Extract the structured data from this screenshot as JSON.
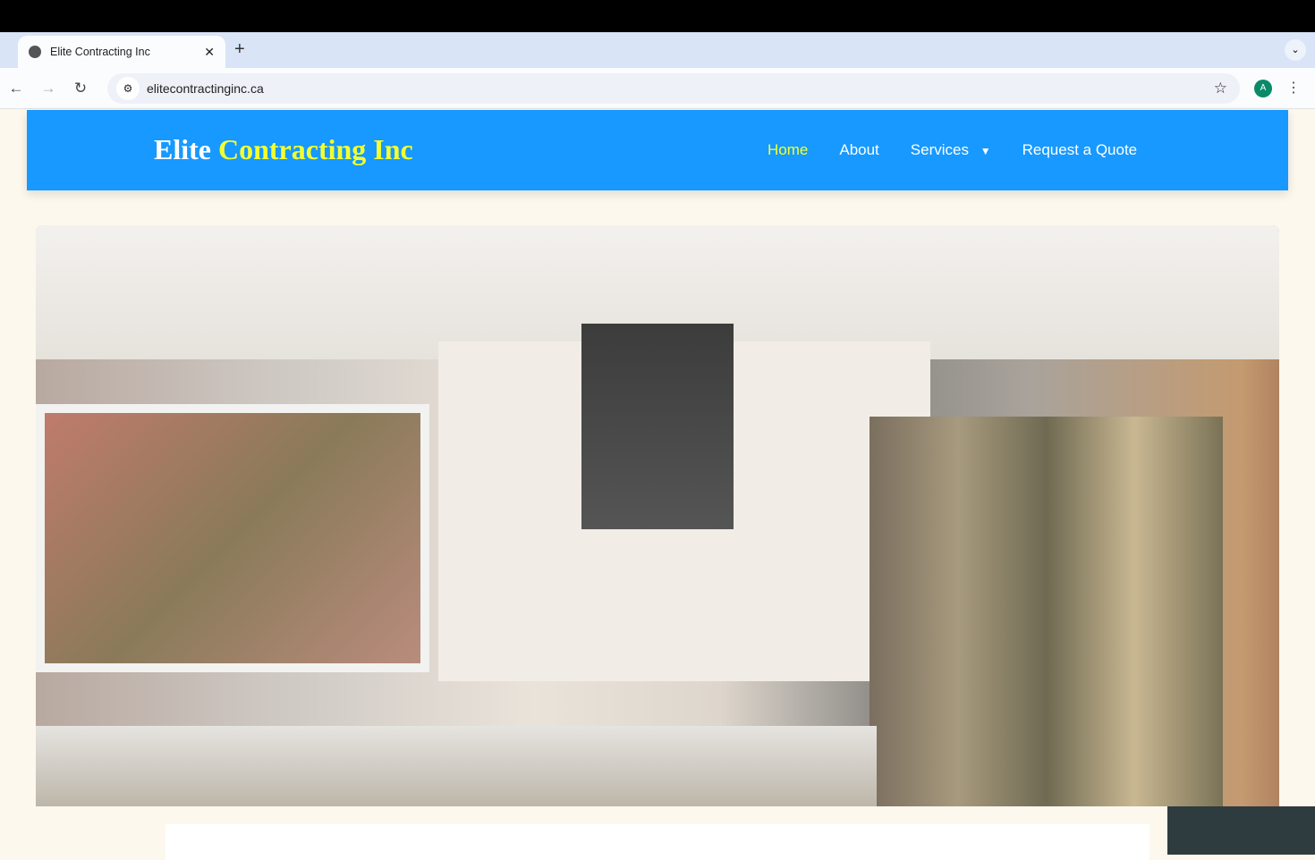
{
  "browser": {
    "tab_title": "Elite Contracting Inc",
    "url": "elitecontractinginc.ca",
    "avatar_letter": "A",
    "icons": {
      "tab": "globe-icon",
      "close": "close-icon",
      "new_tab": "plus-icon",
      "back": "arrow-left-icon",
      "forward": "arrow-right-icon",
      "reload": "reload-icon",
      "site_info": "tune-icon",
      "bookmark": "star-icon",
      "menu": "kebab-menu-icon"
    }
  },
  "site": {
    "logo": {
      "part1": "Elite",
      "part2": "Contracting Inc"
    },
    "nav": [
      {
        "label": "Home",
        "active": true
      },
      {
        "label": "About"
      },
      {
        "label": "Services",
        "dropdown": true
      },
      {
        "label": "Request a Quote"
      }
    ],
    "colors": {
      "nav_bg": "#1799ff",
      "accent": "#f4ff2e",
      "page_bg": "#fcf8ee",
      "dark_panel": "#2e3b3f"
    }
  }
}
